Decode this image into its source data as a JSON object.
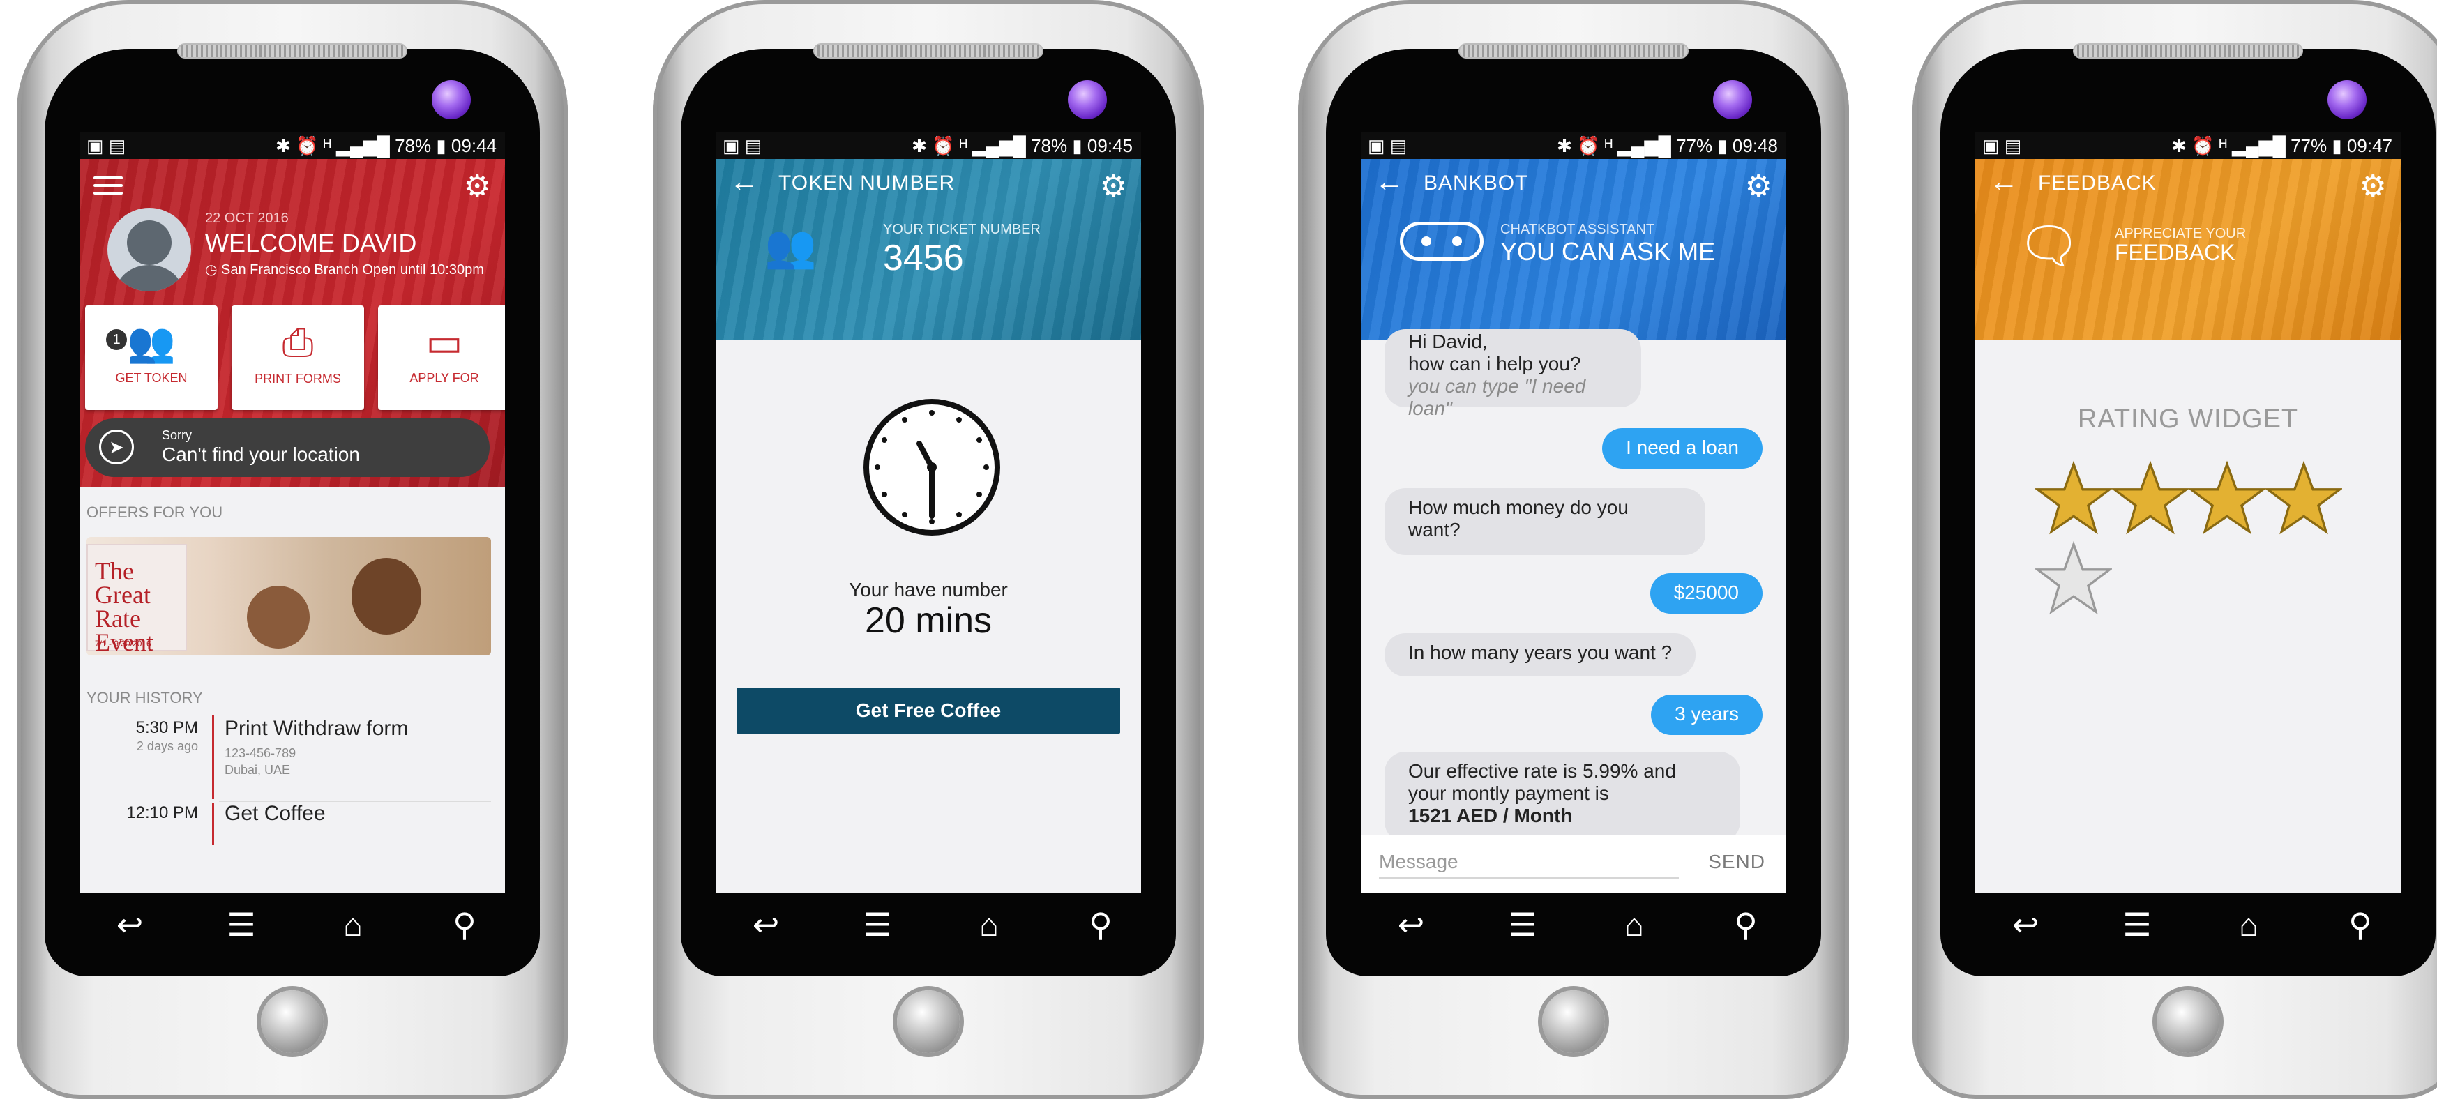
{
  "screens": [
    {
      "status": {
        "time": "09:44",
        "battery": "78%"
      },
      "header": {
        "date": "22 OCT 2016",
        "welcome": "WELCOME DAVID",
        "branch_status": "San Francisco Branch Open until 10:30pm"
      },
      "tiles": [
        {
          "label": "GET TOKEN",
          "badge": "1"
        },
        {
          "label": "PRINT FORMS"
        },
        {
          "label": "APPLY FOR"
        }
      ],
      "location": {
        "line1": "Sorry",
        "line2": "Can't find your location"
      },
      "offers": {
        "heading": "OFFERS FOR YOU",
        "promo_title": "The Great Rate Event",
        "promo_dates": "7/1 - 9/30/2016"
      },
      "history": {
        "heading": "YOUR HISTORY",
        "items": [
          {
            "time": "5:30 PM",
            "when": "2 days ago",
            "title": "Print Withdraw form",
            "meta1": "123-456-789",
            "meta2": "Dubai, UAE"
          },
          {
            "time": "12:10 PM",
            "title": "Get Coffee"
          }
        ]
      }
    },
    {
      "status": {
        "time": "09:45",
        "battery": "78%"
      },
      "title": "TOKEN NUMBER",
      "ticket_label": "YOUR TICKET NUMBER",
      "ticket_number": "3456",
      "wait_label": "Your have number",
      "wait_value": "20 mins",
      "button": "Get Free Coffee"
    },
    {
      "status": {
        "time": "09:48",
        "battery": "77%"
      },
      "title": "BANKBOT",
      "assistant_label": "CHATKBOT ASSISTANT",
      "assistant_title": "YOU CAN ASK ME",
      "messages": [
        {
          "from": "bot",
          "line1": "Hi David,",
          "line2": "how can i help you?",
          "hint": "you can type \"I need loan\""
        },
        {
          "from": "user",
          "text": "I need a loan"
        },
        {
          "from": "bot",
          "line1": "How much money do you",
          "line2": "want?"
        },
        {
          "from": "user",
          "text": "$25000"
        },
        {
          "from": "bot",
          "text": "In how many years you want ?"
        },
        {
          "from": "user",
          "text": "3 years"
        },
        {
          "from": "bot",
          "line1": "Our effective rate is 5.99% and",
          "line2": "your montly payment is",
          "bold": "1521 AED / Month"
        }
      ],
      "input_placeholder": "Message",
      "send_label": "SEND"
    },
    {
      "status": {
        "time": "09:47",
        "battery": "77%"
      },
      "title": "FEEDBACK",
      "sub_label": "APPRECIATE YOUR",
      "sub_title": "FEEDBACK",
      "rating_title": "RATING WIDGET",
      "rating": {
        "value": 4,
        "max": 5
      }
    }
  ],
  "icons": {
    "settings": "gear-icon",
    "back": "arrow-left-icon",
    "menu": "hamburger-menu-icon",
    "nav": [
      "back-nav-icon",
      "menu-nav-icon",
      "home-nav-icon",
      "search-nav-icon"
    ]
  },
  "colors": {
    "red": "#c62a30",
    "teal": "#2f8fb4",
    "blue": "#2c84e2",
    "orange": "#f0a02a",
    "button_dark": "#0d4a66",
    "chat_user": "#2ea3f2"
  }
}
